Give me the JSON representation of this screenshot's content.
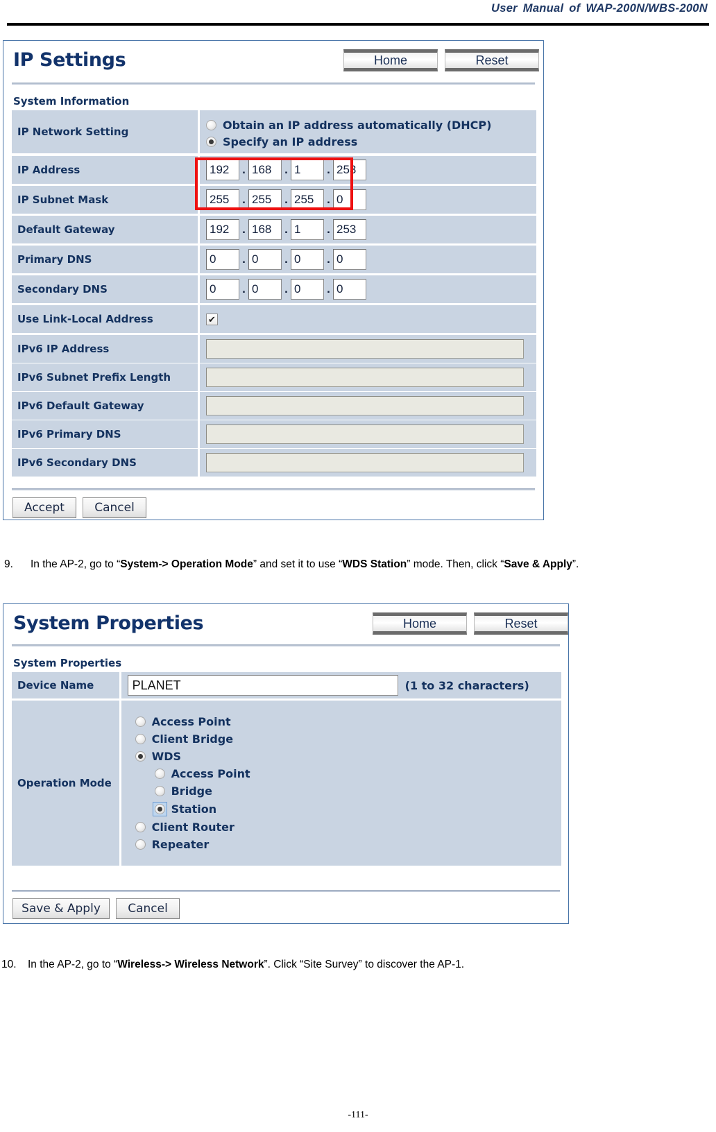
{
  "page": {
    "running_header": "User  Manual  of  WAP-200N/WBS-200N",
    "footer": "-111-"
  },
  "colors": {
    "panel_border": "#4874a8",
    "row_label_bg": "#c9d4e2",
    "heading_blue": "#12336b",
    "highlight_red": "#ee1111"
  },
  "ip_settings_panel": {
    "title": "IP Settings",
    "buttons": {
      "home": "Home",
      "reset": "Reset"
    },
    "section_label": "System Information",
    "rows": [
      {
        "label": "IP Network Setting",
        "type": "radios",
        "options": [
          {
            "label": "Obtain an IP address automatically (DHCP)",
            "checked": false
          },
          {
            "label": "Specify an IP address",
            "checked": true
          }
        ]
      },
      {
        "label": "IP Address",
        "type": "octets",
        "octets": [
          "192",
          "168",
          "1",
          "253"
        ]
      },
      {
        "label": "IP Subnet Mask",
        "type": "octets",
        "octets": [
          "255",
          "255",
          "255",
          "0"
        ]
      },
      {
        "label": "Default Gateway",
        "type": "octets",
        "octets": [
          "192",
          "168",
          "1",
          "253"
        ]
      },
      {
        "label": "Primary DNS",
        "type": "octets",
        "octets": [
          "0",
          "0",
          "0",
          "0"
        ]
      },
      {
        "label": "Secondary DNS",
        "type": "octets",
        "octets": [
          "0",
          "0",
          "0",
          "0"
        ]
      },
      {
        "label": "Use Link-Local Address",
        "type": "checkbox",
        "checked": true,
        "glyph": "✔"
      },
      {
        "label": "IPv6 IP Address",
        "type": "text",
        "value": ""
      },
      {
        "label": "IPv6 Subnet Prefix Length",
        "type": "text",
        "value": ""
      },
      {
        "label": "IPv6 Default Gateway",
        "type": "text",
        "value": ""
      },
      {
        "label": "IPv6 Primary DNS",
        "type": "text",
        "value": ""
      },
      {
        "label": "IPv6 Secondary DNS",
        "type": "text",
        "value": ""
      }
    ],
    "dot_separator": ".",
    "footer_buttons": {
      "accept": "Accept",
      "cancel": "Cancel"
    }
  },
  "step9": {
    "number": "9.",
    "text_1": "In the AP-2, go to “",
    "bold_1": "System-> Operation Mode",
    "text_2": "” and set it to use “",
    "bold_2": "WDS Station",
    "text_3": "” mode. Then, click “",
    "bold_3": "Save & Apply",
    "text_4": "”."
  },
  "system_properties_panel": {
    "title": "System Properties",
    "buttons": {
      "home": "Home",
      "reset": "Reset"
    },
    "section_label": "System Properties",
    "device_name": {
      "label": "Device Name",
      "value": "PLANET",
      "hint": "(1 to 32 characters)"
    },
    "operation_mode": {
      "label": "Operation Mode",
      "options": [
        {
          "label": "Access Point",
          "checked": false,
          "indent": 0,
          "focus": false
        },
        {
          "label": "Client Bridge",
          "checked": false,
          "indent": 0,
          "focus": false
        },
        {
          "label": "WDS",
          "checked": true,
          "indent": 0,
          "focus": false
        },
        {
          "label": "Access Point",
          "checked": false,
          "indent": 1,
          "focus": false
        },
        {
          "label": "Bridge",
          "checked": false,
          "indent": 1,
          "focus": false
        },
        {
          "label": "Station",
          "checked": true,
          "indent": 1,
          "focus": true
        },
        {
          "label": "Client Router",
          "checked": false,
          "indent": 0,
          "focus": false
        },
        {
          "label": "Repeater",
          "checked": false,
          "indent": 0,
          "focus": false
        }
      ]
    },
    "footer_buttons": {
      "save_apply": "Save & Apply",
      "cancel": "Cancel"
    }
  },
  "step10": {
    "number": "10.",
    "text_1": "In the AP-2, go to “",
    "bold_1": "Wireless-> Wireless Network",
    "text_2": "”. Click “Site Survey” to discover the AP-1."
  }
}
